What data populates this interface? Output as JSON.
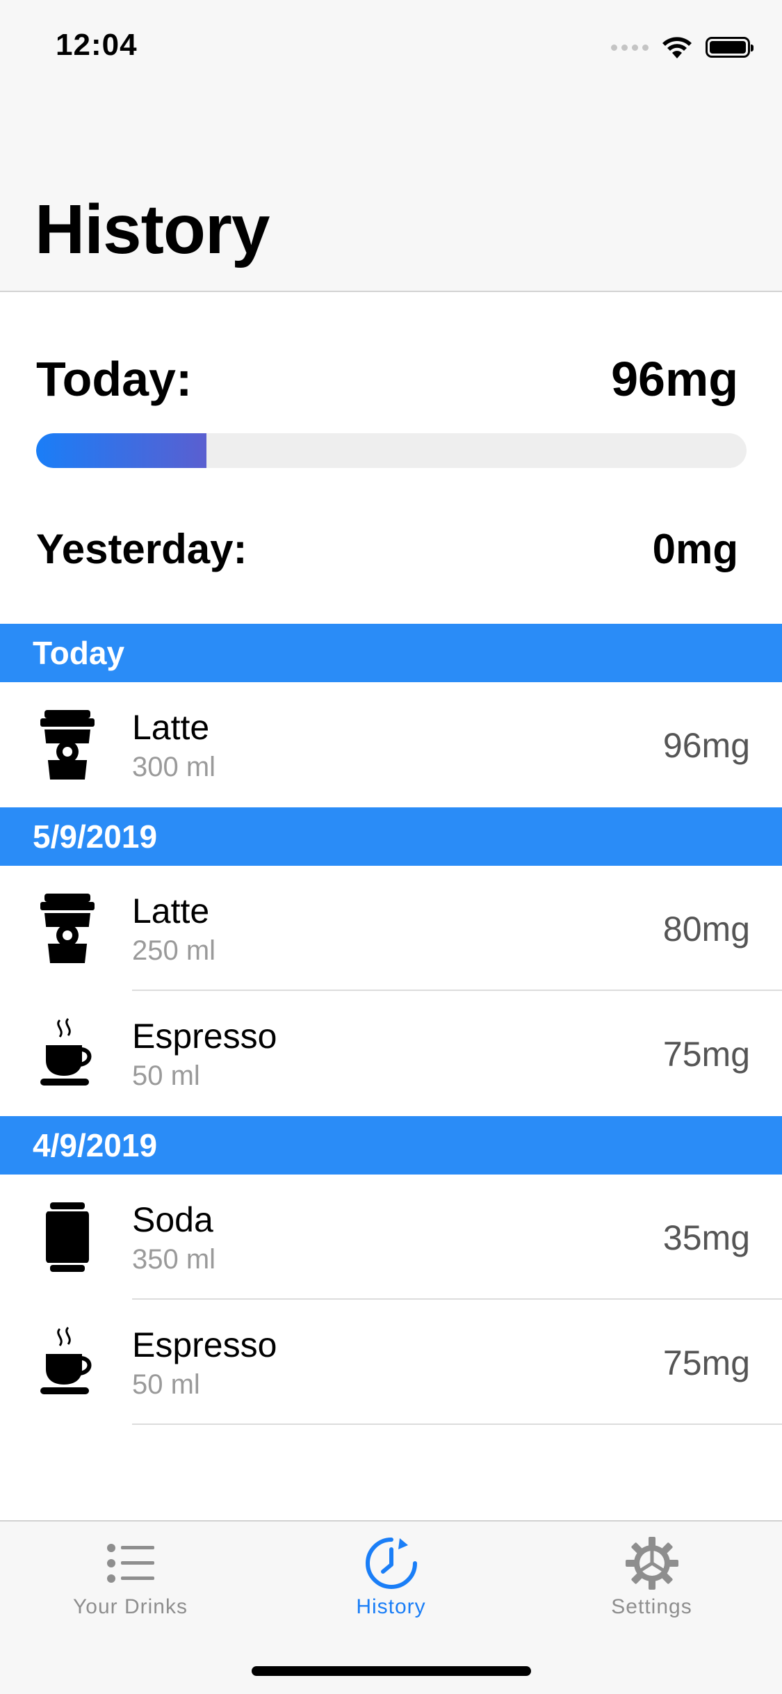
{
  "status_bar": {
    "time": "12:04"
  },
  "header": {
    "title": "History"
  },
  "summary": {
    "today_label": "Today:",
    "today_value": "96mg",
    "today_progress_fraction": 0.24,
    "yesterday_label": "Yesterday:",
    "yesterday_value": "0mg"
  },
  "sections": [
    {
      "title": "Today",
      "items": [
        {
          "name": "Latte",
          "volume": "300 ml",
          "caffeine": "96mg",
          "icon": "latte-cup-icon"
        }
      ]
    },
    {
      "title": "5/9/2019",
      "items": [
        {
          "name": "Latte",
          "volume": "250 ml",
          "caffeine": "80mg",
          "icon": "latte-cup-icon"
        },
        {
          "name": "Espresso",
          "volume": "50 ml",
          "caffeine": "75mg",
          "icon": "espresso-cup-icon"
        }
      ]
    },
    {
      "title": "4/9/2019",
      "items": [
        {
          "name": "Soda",
          "volume": "350 ml",
          "caffeine": "35mg",
          "icon": "soda-can-icon"
        },
        {
          "name": "Espresso",
          "volume": "50 ml",
          "caffeine": "75mg",
          "icon": "espresso-cup-icon"
        }
      ]
    }
  ],
  "tab_bar": {
    "tabs": [
      {
        "label": "Your Drinks",
        "icon": "list-icon",
        "active": false
      },
      {
        "label": "History",
        "icon": "clock-icon",
        "active": true
      },
      {
        "label": "Settings",
        "icon": "gear-icon",
        "active": false
      }
    ]
  },
  "colors": {
    "accent": "#1a7ef7",
    "section_header": "#2a8cf7",
    "progress_start": "#1a7ef7",
    "progress_end": "#5a5fd0",
    "inactive_tab": "#8e8e8e"
  }
}
